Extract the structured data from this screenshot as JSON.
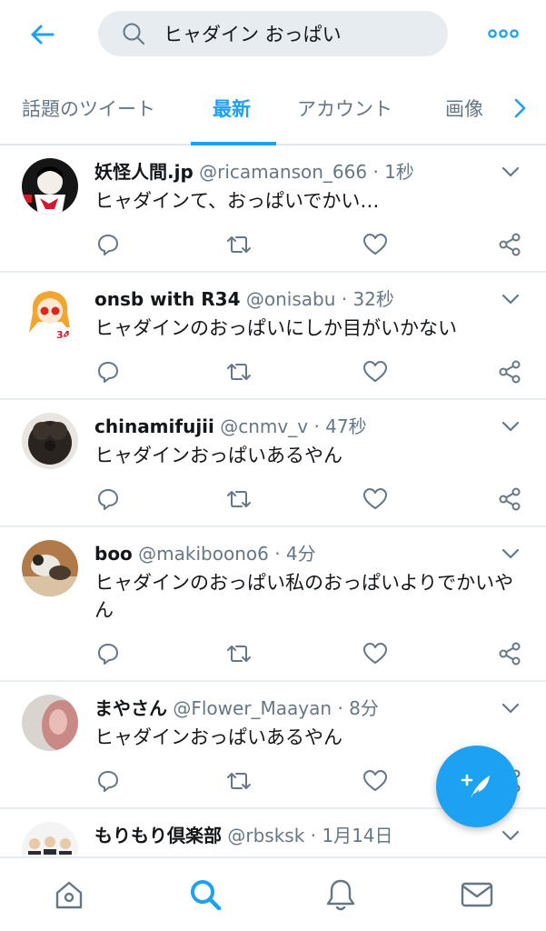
{
  "header": {
    "back_icon": "arrow-left-icon",
    "search_icon": "search-icon",
    "search_value": "ヒャダイン おっぱい",
    "more_icon": "more-dots-icon"
  },
  "tabs": [
    {
      "label": "話題のツイート",
      "active": false
    },
    {
      "label": "最新",
      "active": true
    },
    {
      "label": "アカウント",
      "active": false
    },
    {
      "label": "画像",
      "active": false
    }
  ],
  "tabs_next_icon": "chevron-right-icon",
  "tweets": [
    {
      "name": "妖怪人間.jp",
      "handle": "@ricamanson_666",
      "dot": "·",
      "time": "1秒",
      "text": "ヒャダインて、おっぱいでかい…"
    },
    {
      "name": "onsb with R34",
      "handle": "@onisabu",
      "dot": "·",
      "time": "32秒",
      "text": "ヒャダインのおっぱいにしか目がいかない"
    },
    {
      "name": "chinamifujii",
      "handle": "@cnmv_v",
      "dot": "·",
      "time": "47秒",
      "text": "ヒャダインおっぱいあるやん"
    },
    {
      "name": "boo",
      "handle": "@makiboono6",
      "dot": "·",
      "time": "4分",
      "text": "ヒャダインのおっぱい私のおっぱいよりでかいやん"
    },
    {
      "name": "まやさん",
      "handle": "@Flower_Maayan",
      "dot": "·",
      "time": "8分",
      "text": "ヒャダインおっぱいあるやん"
    },
    {
      "name": "もりもり倶楽部",
      "handle": "@rbsksk",
      "dot": "·",
      "time": "1月14日",
      "text": ""
    }
  ],
  "tweet_action_icons": [
    "reply-icon",
    "retweet-icon",
    "like-icon",
    "share-icon"
  ],
  "fab_icon": "compose-tweet-icon",
  "bottom_nav": [
    "home-icon",
    "search-icon",
    "notifications-bell-icon",
    "messages-envelope-icon"
  ],
  "colors": {
    "accent": "#1da1f2",
    "secondary_text": "#657786",
    "primary_text": "#14171a",
    "search_bg": "#e6ecf0",
    "divider": "#e6ecf0"
  }
}
